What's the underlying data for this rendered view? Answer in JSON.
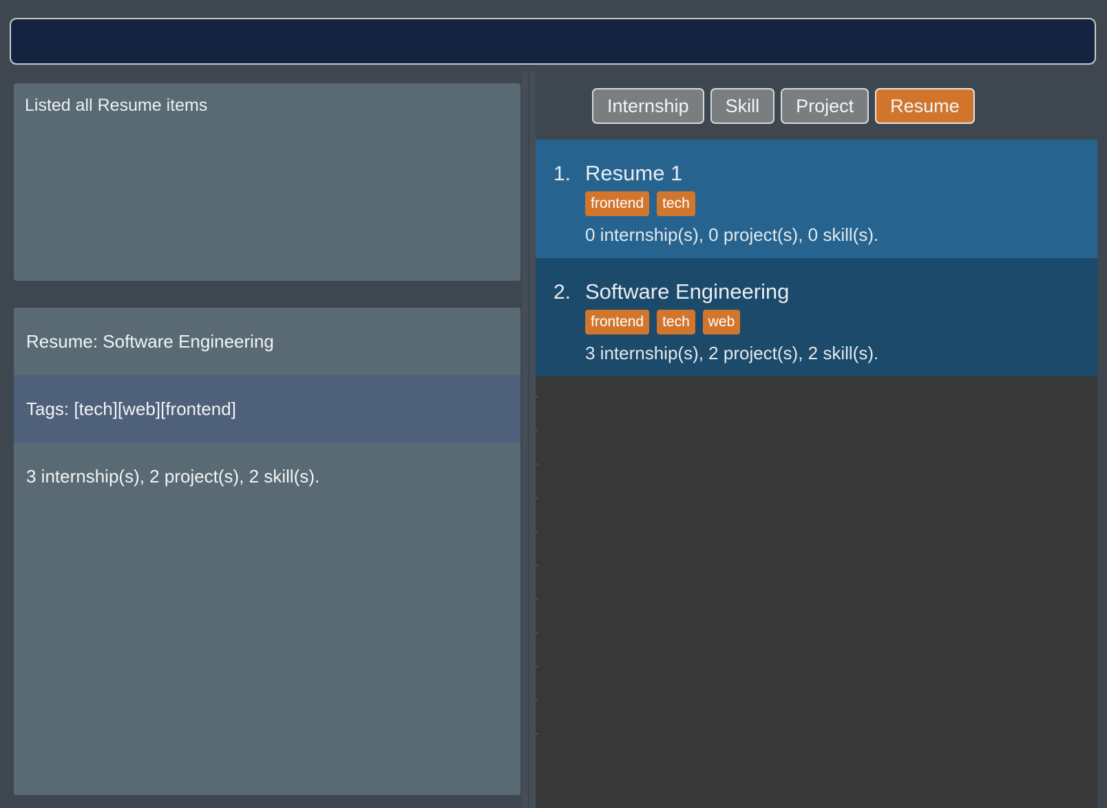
{
  "topbar": {
    "value": "",
    "placeholder": ""
  },
  "left": {
    "status": {
      "message": "Listed all Resume items"
    },
    "detail": {
      "rows": [
        {
          "text": "Resume: Software Engineering",
          "selected": false
        },
        {
          "text": "Tags: [tech][web][frontend]",
          "selected": true
        },
        {
          "text": "3 internship(s), 2 project(s), 2 skill(s).",
          "selected": false
        }
      ]
    }
  },
  "right": {
    "tabs": [
      {
        "label": "Internship",
        "active": false
      },
      {
        "label": "Skill",
        "active": false
      },
      {
        "label": "Project",
        "active": false
      },
      {
        "label": "Resume",
        "active": true
      }
    ],
    "list": {
      "items": [
        {
          "index": "1.",
          "title": "Resume 1",
          "tags": [
            "frontend",
            "tech"
          ],
          "meta": "0 internship(s), 0 project(s), 0 skill(s)."
        },
        {
          "index": "2.",
          "title": "Software Engineering",
          "tags": [
            "frontend",
            "tech",
            "web"
          ],
          "meta": "3 internship(s), 2 project(s), 2 skill(s)."
        }
      ]
    }
  },
  "colors": {
    "accent_orange": "#d2752c",
    "item_blue": "#26648f",
    "item_blue_selected": "#1c4a6b",
    "panel_gray": "#596a74",
    "row_highlight": "#4e607a",
    "app_background": "#3e474f",
    "list_background": "#383838",
    "topbar_field": "#132340"
  }
}
